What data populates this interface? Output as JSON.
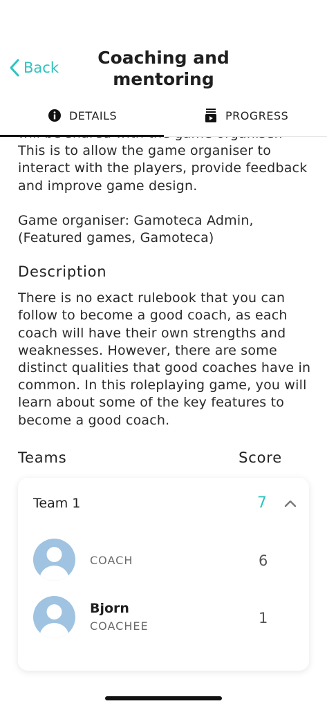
{
  "header": {
    "back_label": "Back",
    "title_line1": "Coaching and",
    "title_line2": "mentoring"
  },
  "tabs": [
    {
      "label": "DETAILS",
      "icon": "info-icon",
      "active": true
    },
    {
      "label": "PROGRESS",
      "icon": "progress-icon",
      "active": false
    }
  ],
  "details": {
    "cut_text_line1": "will be shared with the game organiser. This",
    "cut_text_rest": "is to allow the game organiser to interact with the players, provide feedback and improve game design.",
    "organiser_line1": "Game organiser: Gamoteca Admin,",
    "organiser_line2": "(Featured games, Gamoteca)",
    "description_title": "Description",
    "description_text": "There is no exact rulebook that you can follow to become a good coach, as each coach will have their own strengths and weaknesses. However, there are some distinct qualities that good coaches have in common. In this roleplaying game, you will learn about some of the key features to become a good coach."
  },
  "teams": {
    "header_label": "Teams",
    "score_label": "Score",
    "list": [
      {
        "name": "Team 1",
        "score": "7",
        "members": [
          {
            "name": "",
            "role": "COACH",
            "score": "6"
          },
          {
            "name": "Bjorn",
            "role": "COACHEE",
            "score": "1"
          }
        ]
      }
    ]
  },
  "colors": {
    "accent": "#2fc3bf",
    "avatar": "#9fc3e0"
  }
}
